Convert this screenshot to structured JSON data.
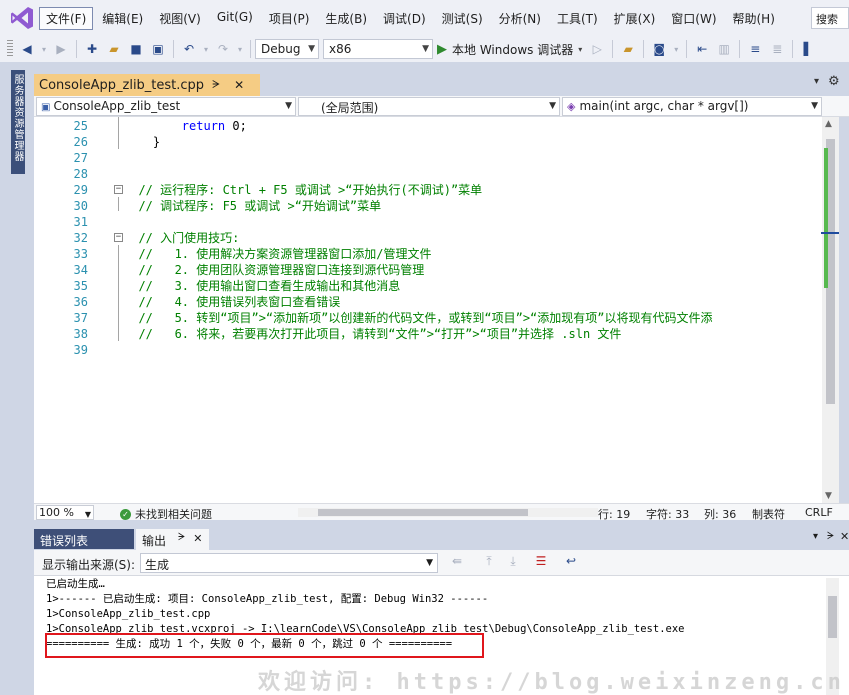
{
  "menu": {
    "items": [
      "文件(F)",
      "编辑(E)",
      "视图(V)",
      "Git(G)",
      "项目(P)",
      "生成(B)",
      "调试(D)",
      "测试(S)",
      "分析(N)",
      "工具(T)",
      "扩展(X)",
      "窗口(W)",
      "帮助(H)"
    ],
    "search_text": "搜索"
  },
  "toolbar": {
    "config": "Debug",
    "platform": "x86",
    "debugger": "本地 Windows 调试器"
  },
  "side_tab": "服务器资源管理器",
  "document": {
    "tab_title": "ConsoleApp_zlib_test.cpp",
    "pin_glyph": "ᗒ",
    "nav_project": "ConsoleApp_zlib_test",
    "nav_scope": "(全局范围)",
    "nav_function": "main(int argc, char * argv[])"
  },
  "code": {
    "lines": [
      {
        "num": "25",
        "parts": [
          {
            "t": "        ",
            "c": ""
          },
          {
            "t": "return",
            "c": "blue"
          },
          {
            "t": " 0;",
            "c": ""
          }
        ]
      },
      {
        "num": "26",
        "parts": [
          {
            "t": "    }",
            "c": ""
          }
        ]
      },
      {
        "num": "27",
        "parts": []
      },
      {
        "num": "28",
        "parts": []
      },
      {
        "num": "29",
        "parts": [
          {
            "t": "  // 运行程序: Ctrl + F5 或调试 >“开始执行(不调试)”菜单",
            "c": "green"
          }
        ]
      },
      {
        "num": "30",
        "parts": [
          {
            "t": "  // 调试程序: F5 或调试 >“开始调试”菜单",
            "c": "green"
          }
        ]
      },
      {
        "num": "31",
        "parts": []
      },
      {
        "num": "32",
        "parts": [
          {
            "t": "  // 入门使用技巧:",
            "c": "green"
          }
        ]
      },
      {
        "num": "33",
        "parts": [
          {
            "t": "  //   1. 使用解决方案资源管理器窗口添加/管理文件",
            "c": "green"
          }
        ]
      },
      {
        "num": "34",
        "parts": [
          {
            "t": "  //   2. 使用团队资源管理器窗口连接到源代码管理",
            "c": "green"
          }
        ]
      },
      {
        "num": "35",
        "parts": [
          {
            "t": "  //   3. 使用输出窗口查看生成输出和其他消息",
            "c": "green"
          }
        ]
      },
      {
        "num": "36",
        "parts": [
          {
            "t": "  //   4. 使用错误列表窗口查看错误",
            "c": "green"
          }
        ]
      },
      {
        "num": "37",
        "parts": [
          {
            "t": "  //   5. 转到“项目”>“添加新项”以创建新的代码文件，或转到“项目”>“添加现有项”以将现有代码文件添",
            "c": "green"
          }
        ]
      },
      {
        "num": "38",
        "parts": [
          {
            "t": "  //   6. 将来，若要再次打开此项目，请转到“文件”>“打开”>“项目”并选择 .sln 文件",
            "c": "green"
          }
        ]
      },
      {
        "num": "39",
        "parts": []
      }
    ]
  },
  "status": {
    "zoom": "100 %",
    "issues": "未找到相关问题",
    "line": "行: 19",
    "char": "字符: 33",
    "col": "列: 36",
    "tabs": "制表符",
    "eol": "CRLF"
  },
  "panel": {
    "tab_errors": "错误列表",
    "tab_output": "输出",
    "source_label": "显示输出来源(S):",
    "source_value": "生成",
    "lines": [
      "已启动生成…",
      "1>------ 已启动生成: 项目: ConsoleApp_zlib_test, 配置: Debug Win32 ------",
      "1>ConsoleApp_zlib_test.cpp",
      "1>ConsoleApp_zlib_test.vcxproj -> I:\\learnCode\\VS\\ConsoleApp_zlib_test\\Debug\\ConsoleApp_zlib_test.exe",
      "========== 生成: 成功 1 个，失败 0 个，最新 0 个，跳过 0 个 =========="
    ]
  },
  "watermark": "欢迎访问: https://blog.weixinzeng.cn"
}
